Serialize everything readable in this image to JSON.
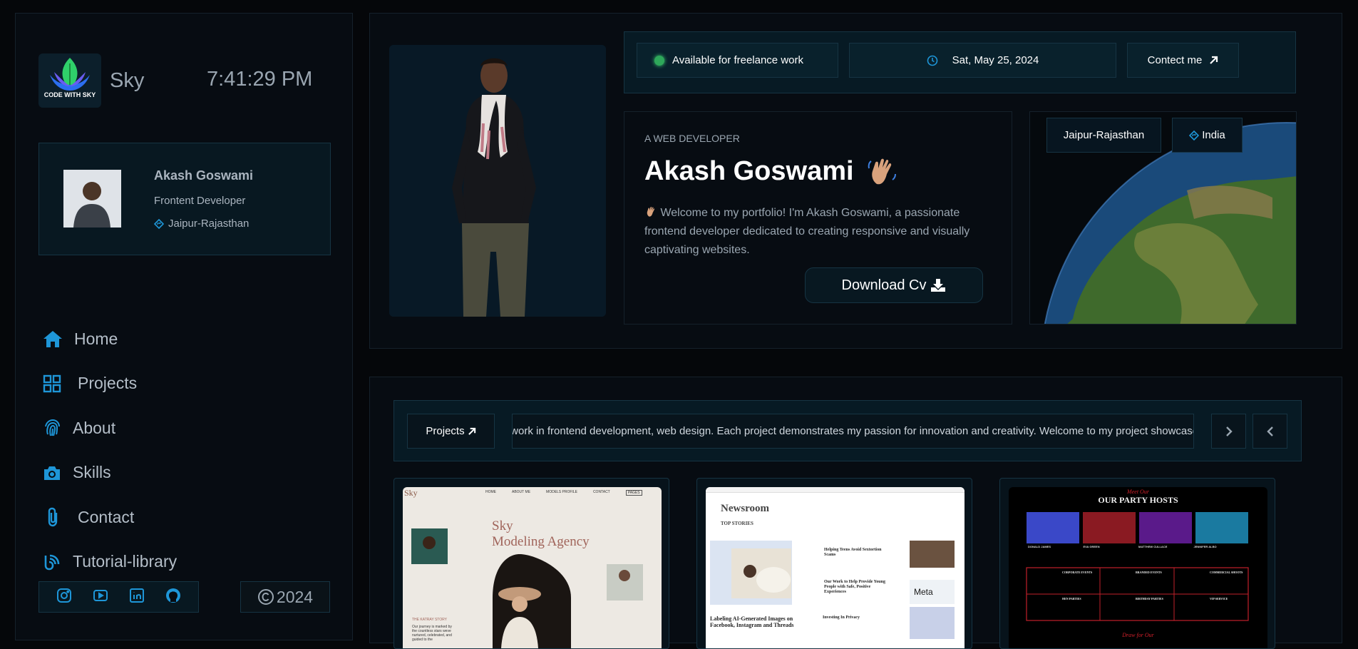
{
  "sidebar": {
    "brand_name": "Sky",
    "logo_text": "CODE WITH SKY",
    "clock": "7:41:29 PM",
    "profile": {
      "name": "Akash Goswami",
      "role": "Frontent Developer",
      "location": "Jaipur-Rajasthan"
    },
    "nav": [
      {
        "label": "Home",
        "icon": "home-icon"
      },
      {
        "label": "Projects",
        "icon": "grid-icon"
      },
      {
        "label": "About",
        "icon": "fingerprint-icon"
      },
      {
        "label": "Skills",
        "icon": "camera-icon"
      },
      {
        "label": "Contact",
        "icon": "paperclip-icon"
      },
      {
        "label": "Tutorial-library",
        "icon": "blog-icon"
      }
    ],
    "social": [
      "instagram-icon",
      "youtube-icon",
      "linkedin-icon",
      "github-icon"
    ],
    "copyright": "2024"
  },
  "hero": {
    "status": "Available for freelance work",
    "date": "Sat, May 25, 2024",
    "contact_label": "Contect me",
    "kicker": "A WEB DEVELOPER",
    "name": "Akash Goswami",
    "description": "Welcome to my portfolio! I'm Akash Goswami, a passionate frontend developer dedicated to creating responsive and visually captivating websites.",
    "download_label": "Download Cv",
    "city": "Jaipur-Rajasthan",
    "country": "India"
  },
  "projects": {
    "button_label": "Projects",
    "marquee": "r work in frontend development, web design. Each project demonstrates my passion for innovation and creativity. Welcome to my project showcase",
    "cards": [
      {
        "brand": "Sky",
        "nav": [
          "HOME",
          "ABOUT ME",
          "MODELS PROFILE",
          "CONTACT",
          "PAGES"
        ],
        "headline_1": "Sky",
        "headline_2": "Modeling Agency",
        "section": "THE KATRAY STORY",
        "blurb": "Our journey is marked by the countless stars weve nurtured, celebrated, and guided to the"
      },
      {
        "title": "Newsroom",
        "subtitle": "TOP STORIES",
        "brand": "Meta",
        "items": [
          "Helping Teens Avoid Sextortion Scams",
          "Our Work to Help Provide Young People with Safe, Positive Experiences",
          "Labeling AI-Generated Images on Facebook, Instagram and Threads",
          "Investing In Privacy"
        ]
      },
      {
        "top_label": "Meet Our",
        "title": "OUR PARTY HOSTS",
        "hosts": [
          "DONALD JAMES",
          "EVA GREEN",
          "MATTHEW CULLACE",
          "JENNIFER ALBO"
        ],
        "services": [
          "CORPORATE EVENTS",
          "BRANDED EVENTS",
          "COMMERCIAL SHOOTS",
          "HEN PARTIES",
          "BIRTHDAY PARTIES",
          "VIP SERVICE"
        ],
        "bottom_label": "Draw for Our"
      }
    ]
  },
  "colors": {
    "accent": "#1e96d8",
    "status_green": "#2ea85a",
    "panel": "#071a24"
  }
}
